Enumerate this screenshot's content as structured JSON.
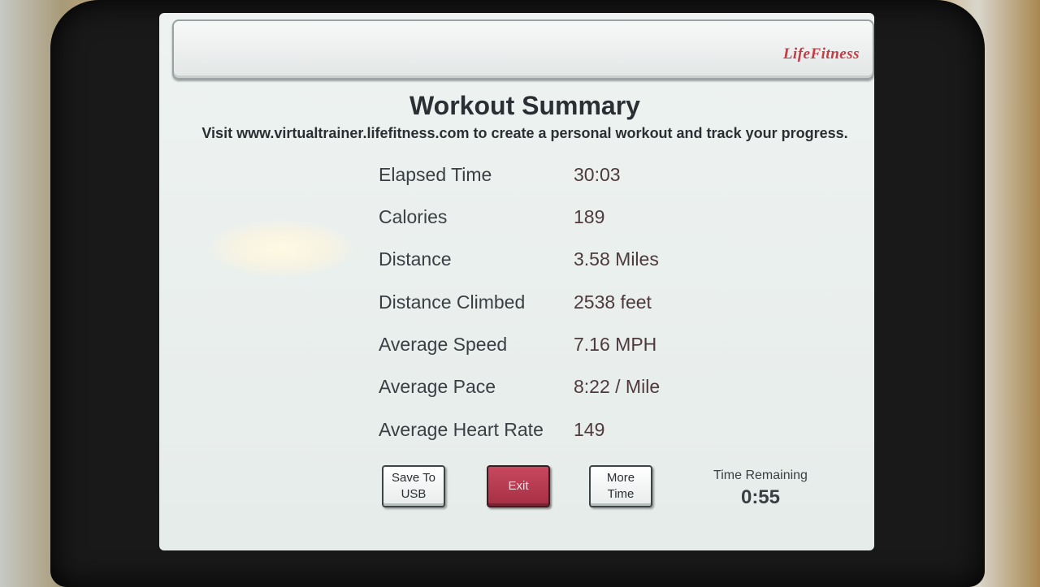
{
  "header": {
    "logo": "LifeFitness"
  },
  "summary": {
    "title": "Workout Summary",
    "subtitle": "Visit www.virtualtrainer.lifefitness.com to create a personal workout and track your progress."
  },
  "stats": [
    {
      "label": "Elapsed Time",
      "value": "30:03"
    },
    {
      "label": "Calories",
      "value": "189"
    },
    {
      "label": "Distance",
      "value": "3.58 Miles"
    },
    {
      "label": "Distance Climbed",
      "value": "2538 feet"
    },
    {
      "label": "Average Speed",
      "value": "7.16 MPH"
    },
    {
      "label": "Average Pace",
      "value": "8:22 / Mile"
    },
    {
      "label": "Average Heart Rate",
      "value": "149"
    }
  ],
  "buttons": {
    "save_line1": "Save To",
    "save_line2": "USB",
    "exit": "Exit",
    "more_line1": "More",
    "more_line2": "Time"
  },
  "time_remaining": {
    "label": "Time Remaining",
    "value": "0:55"
  },
  "colors": {
    "exit_button": "#b33a50",
    "logo": "#c53a45",
    "screen": "#e9eeec"
  }
}
